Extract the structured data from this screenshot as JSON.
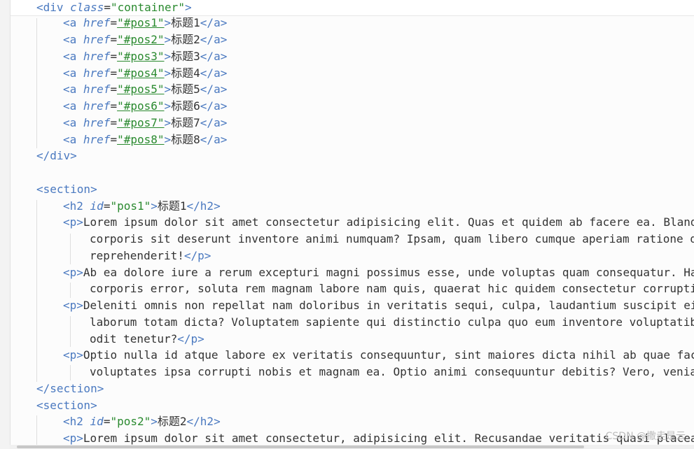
{
  "editor": {
    "watermark": "CSDN @撒走是云"
  },
  "lines": {
    "container_open": {
      "tag": "<div",
      "attr": "class",
      "value": "\"container\"",
      "close": ">"
    },
    "links": [
      {
        "open": "<a",
        "attr": "href",
        "value": "\"#pos1\"",
        "text": "标题1",
        "close": "</a>"
      },
      {
        "open": "<a",
        "attr": "href",
        "value": "\"#pos2\"",
        "text": "标题2",
        "close": "</a>"
      },
      {
        "open": "<a",
        "attr": "href",
        "value": "\"#pos3\"",
        "text": "标题3",
        "close": "</a>"
      },
      {
        "open": "<a",
        "attr": "href",
        "value": "\"#pos4\"",
        "text": "标题4",
        "close": "</a>"
      },
      {
        "open": "<a",
        "attr": "href",
        "value": "\"#pos5\"",
        "text": "标题5",
        "close": "</a>"
      },
      {
        "open": "<a",
        "attr": "href",
        "value": "\"#pos6\"",
        "text": "标题6",
        "close": "</a>"
      },
      {
        "open": "<a",
        "attr": "href",
        "value": "\"#pos7\"",
        "text": "标题7",
        "close": "</a>"
      },
      {
        "open": "<a",
        "attr": "href",
        "value": "\"#pos8\"",
        "text": "标题8",
        "close": "</a>"
      }
    ],
    "container_close": "</div>",
    "section1_open": "<section>",
    "section1_h2": {
      "open": "<h2",
      "attr": "id",
      "value": "\"pos1\"",
      "text": "标题1",
      "close": "</h2>"
    },
    "p1": {
      "open": "<p>",
      "line1": "Lorem ipsum dolor sit amet consectetur adipisicing elit. Quas et quidem ab facere ea. Blanditiis",
      "line2": "corporis sit deserunt inventore animi numquam? Ipsam, quam libero cumque aperiam ratione dolores",
      "line3": "reprehenderit!",
      "close": "</p>"
    },
    "p2": {
      "open": "<p>",
      "line1": "Ab ea dolore iure a rerum excepturi magni possimus esse, unde voluptas quam consequatur. Harum",
      "line2": "corporis error, soluta rem magnam labore nam quis, quaerat hic quidem consectetur corrupti"
    },
    "p3": {
      "open": "<p>",
      "line1": "Deleniti omnis non repellat nam doloribus in veritatis sequi, culpa, laudantium suscipit eius",
      "line2": "laborum totam dicta? Voluptatem sapiente qui distinctio culpa quo eum inventore voluptatibus",
      "line3": "odit tenetur?",
      "close": "</p>"
    },
    "p4": {
      "open": "<p>",
      "line1": "Optio nulla id atque labore ex veritatis consequuntur, sint maiores dicta nihil ab quae facere",
      "line2": "voluptates ipsa corrupti nobis et magnam ea. Optio animi consequuntur debitis? Vero, veniam"
    },
    "section1_close": "</section>",
    "section2_open": "<section>",
    "section2_h2": {
      "open": "<h2",
      "attr": "id",
      "value": "\"pos2\"",
      "text": "标题2",
      "close": "</h2>"
    },
    "p5": {
      "open": "<p>",
      "line1": "Lorem ipsum dolor sit amet consectetur, adipisicing elit. Recusandae veritatis quasi placeat"
    }
  }
}
